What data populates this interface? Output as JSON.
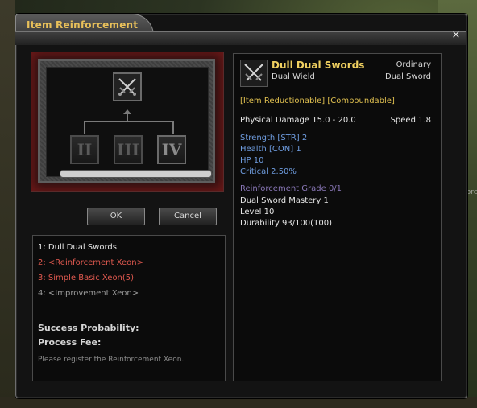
{
  "window": {
    "title": "Item Reinforcement",
    "close_glyph": "×"
  },
  "background": {
    "ghost_text": "Reinforcem"
  },
  "slots": {
    "main_icon": "dual-swords-icon",
    "ii": "II",
    "iii": "III",
    "iv": "IV"
  },
  "buttons": {
    "ok": "OK",
    "cancel": "Cancel"
  },
  "requirements": [
    {
      "text": "1: Dull Dual Swords",
      "color": "#e6e6e6"
    },
    {
      "text": "2: <Reinforcement Xeon>",
      "color": "#e0594f"
    },
    {
      "text": "3: Simple Basic Xeon(5)",
      "color": "#e0594f"
    },
    {
      "text": "4: <Improvement Xeon>",
      "color": "#9c9c9c"
    }
  ],
  "labels": {
    "success_probability": "Success Probability:",
    "process_fee": "Process Fee:",
    "hint": "Please register the Reinforcement Xeon."
  },
  "item": {
    "name": "Dull Dual Swords",
    "rarity": "Ordinary",
    "wield": "Dual Wield",
    "category": "Dual Sword",
    "tags": "[Item Reductionable] [Compoundable]",
    "physical_damage": "Physical Damage 15.0 - 20.0",
    "speed": "Speed 1.8",
    "stats": [
      "Strength [STR] 2",
      "Health [CON] 1",
      "HP 10",
      "Critical 2.50%"
    ],
    "reinforcement_grade": "Reinforcement Grade 0/1",
    "details": [
      "Dual Sword Mastery 1",
      "Level 10",
      "Durability 93/100(100)"
    ]
  },
  "colors": {
    "title": "#e8c05a",
    "item_name": "#f0d060",
    "tags": "#e0c050",
    "stats": "#6f9de0",
    "grade": "#8a78b8",
    "requirement_red": "#e0594f"
  }
}
